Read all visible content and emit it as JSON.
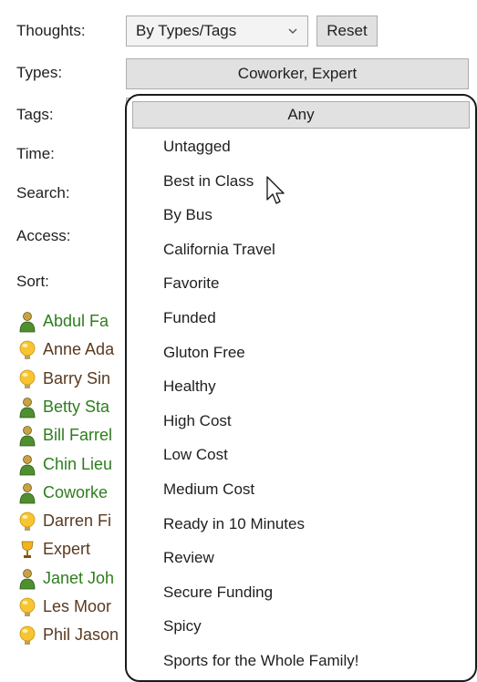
{
  "filters": {
    "thoughts_label": "Thoughts:",
    "thoughts_value": "By Types/Tags",
    "reset_label": "Reset",
    "types_label": "Types:",
    "types_value": "Coworker, Expert",
    "tags_label": "Tags:",
    "time_label": "Time:",
    "search_label": "Search:",
    "access_label": "Access:",
    "sort_label": "Sort:"
  },
  "people": [
    {
      "name": "Abdul Fa",
      "icon": "person-icon",
      "color": "#2e7d1e"
    },
    {
      "name": "Anne Ada",
      "icon": "bulb-icon",
      "color": "#5a3a20"
    },
    {
      "name": "Barry Sin",
      "icon": "bulb-icon",
      "color": "#5a3a20"
    },
    {
      "name": "Betty Sta",
      "icon": "person-icon",
      "color": "#2e7d1e"
    },
    {
      "name": "Bill Farrel",
      "icon": "person-icon",
      "color": "#2e7d1e"
    },
    {
      "name": "Chin Lieu",
      "icon": "person-icon",
      "color": "#2e7d1e"
    },
    {
      "name": "Coworke",
      "icon": "person-icon",
      "color": "#2e7d1e"
    },
    {
      "name": "Darren Fi",
      "icon": "bulb-icon",
      "color": "#5a3a20"
    },
    {
      "name": "Expert",
      "icon": "trophy-icon",
      "color": "#5a3a20"
    },
    {
      "name": "Janet Joh",
      "icon": "person-icon",
      "color": "#2e7d1e"
    },
    {
      "name": "Les Moor",
      "icon": "bulb-icon",
      "color": "#5a3a20"
    },
    {
      "name": "Phil Jason",
      "icon": "bulb-icon",
      "color": "#5a3a20"
    }
  ],
  "tags_dropdown": {
    "selected": "Any",
    "items": [
      "Untagged",
      "Best in Class",
      "By Bus",
      "California Travel",
      "Favorite",
      "Funded",
      "Gluton Free",
      "Healthy",
      "High Cost",
      "Low Cost",
      "Medium Cost",
      "Ready in 10 Minutes",
      "Review",
      "Secure Funding",
      "Spicy",
      "Sports for the Whole Family!"
    ]
  },
  "colors": {
    "person_green": "#2e7d1e",
    "thought_brown": "#5a3a20",
    "button_gray": "#e1e1e1"
  }
}
